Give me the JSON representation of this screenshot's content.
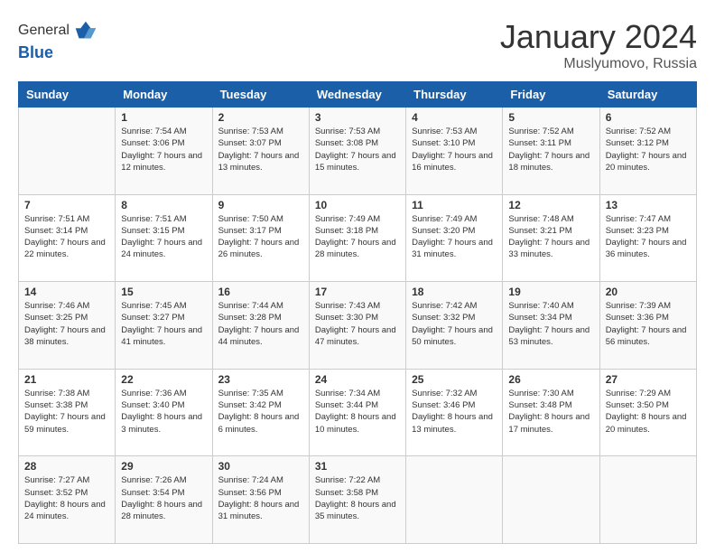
{
  "logo": {
    "line1": "General",
    "line2": "Blue"
  },
  "title": "January 2024",
  "subtitle": "Muslyumovo, Russia",
  "weekdays": [
    "Sunday",
    "Monday",
    "Tuesday",
    "Wednesday",
    "Thursday",
    "Friday",
    "Saturday"
  ],
  "weeks": [
    [
      {
        "day": "",
        "sunrise": "",
        "sunset": "",
        "daylight": ""
      },
      {
        "day": "1",
        "sunrise": "Sunrise: 7:54 AM",
        "sunset": "Sunset: 3:06 PM",
        "daylight": "Daylight: 7 hours and 12 minutes."
      },
      {
        "day": "2",
        "sunrise": "Sunrise: 7:53 AM",
        "sunset": "Sunset: 3:07 PM",
        "daylight": "Daylight: 7 hours and 13 minutes."
      },
      {
        "day": "3",
        "sunrise": "Sunrise: 7:53 AM",
        "sunset": "Sunset: 3:08 PM",
        "daylight": "Daylight: 7 hours and 15 minutes."
      },
      {
        "day": "4",
        "sunrise": "Sunrise: 7:53 AM",
        "sunset": "Sunset: 3:10 PM",
        "daylight": "Daylight: 7 hours and 16 minutes."
      },
      {
        "day": "5",
        "sunrise": "Sunrise: 7:52 AM",
        "sunset": "Sunset: 3:11 PM",
        "daylight": "Daylight: 7 hours and 18 minutes."
      },
      {
        "day": "6",
        "sunrise": "Sunrise: 7:52 AM",
        "sunset": "Sunset: 3:12 PM",
        "daylight": "Daylight: 7 hours and 20 minutes."
      }
    ],
    [
      {
        "day": "7",
        "sunrise": "Sunrise: 7:51 AM",
        "sunset": "Sunset: 3:14 PM",
        "daylight": "Daylight: 7 hours and 22 minutes."
      },
      {
        "day": "8",
        "sunrise": "Sunrise: 7:51 AM",
        "sunset": "Sunset: 3:15 PM",
        "daylight": "Daylight: 7 hours and 24 minutes."
      },
      {
        "day": "9",
        "sunrise": "Sunrise: 7:50 AM",
        "sunset": "Sunset: 3:17 PM",
        "daylight": "Daylight: 7 hours and 26 minutes."
      },
      {
        "day": "10",
        "sunrise": "Sunrise: 7:49 AM",
        "sunset": "Sunset: 3:18 PM",
        "daylight": "Daylight: 7 hours and 28 minutes."
      },
      {
        "day": "11",
        "sunrise": "Sunrise: 7:49 AM",
        "sunset": "Sunset: 3:20 PM",
        "daylight": "Daylight: 7 hours and 31 minutes."
      },
      {
        "day": "12",
        "sunrise": "Sunrise: 7:48 AM",
        "sunset": "Sunset: 3:21 PM",
        "daylight": "Daylight: 7 hours and 33 minutes."
      },
      {
        "day": "13",
        "sunrise": "Sunrise: 7:47 AM",
        "sunset": "Sunset: 3:23 PM",
        "daylight": "Daylight: 7 hours and 36 minutes."
      }
    ],
    [
      {
        "day": "14",
        "sunrise": "Sunrise: 7:46 AM",
        "sunset": "Sunset: 3:25 PM",
        "daylight": "Daylight: 7 hours and 38 minutes."
      },
      {
        "day": "15",
        "sunrise": "Sunrise: 7:45 AM",
        "sunset": "Sunset: 3:27 PM",
        "daylight": "Daylight: 7 hours and 41 minutes."
      },
      {
        "day": "16",
        "sunrise": "Sunrise: 7:44 AM",
        "sunset": "Sunset: 3:28 PM",
        "daylight": "Daylight: 7 hours and 44 minutes."
      },
      {
        "day": "17",
        "sunrise": "Sunrise: 7:43 AM",
        "sunset": "Sunset: 3:30 PM",
        "daylight": "Daylight: 7 hours and 47 minutes."
      },
      {
        "day": "18",
        "sunrise": "Sunrise: 7:42 AM",
        "sunset": "Sunset: 3:32 PM",
        "daylight": "Daylight: 7 hours and 50 minutes."
      },
      {
        "day": "19",
        "sunrise": "Sunrise: 7:40 AM",
        "sunset": "Sunset: 3:34 PM",
        "daylight": "Daylight: 7 hours and 53 minutes."
      },
      {
        "day": "20",
        "sunrise": "Sunrise: 7:39 AM",
        "sunset": "Sunset: 3:36 PM",
        "daylight": "Daylight: 7 hours and 56 minutes."
      }
    ],
    [
      {
        "day": "21",
        "sunrise": "Sunrise: 7:38 AM",
        "sunset": "Sunset: 3:38 PM",
        "daylight": "Daylight: 7 hours and 59 minutes."
      },
      {
        "day": "22",
        "sunrise": "Sunrise: 7:36 AM",
        "sunset": "Sunset: 3:40 PM",
        "daylight": "Daylight: 8 hours and 3 minutes."
      },
      {
        "day": "23",
        "sunrise": "Sunrise: 7:35 AM",
        "sunset": "Sunset: 3:42 PM",
        "daylight": "Daylight: 8 hours and 6 minutes."
      },
      {
        "day": "24",
        "sunrise": "Sunrise: 7:34 AM",
        "sunset": "Sunset: 3:44 PM",
        "daylight": "Daylight: 8 hours and 10 minutes."
      },
      {
        "day": "25",
        "sunrise": "Sunrise: 7:32 AM",
        "sunset": "Sunset: 3:46 PM",
        "daylight": "Daylight: 8 hours and 13 minutes."
      },
      {
        "day": "26",
        "sunrise": "Sunrise: 7:30 AM",
        "sunset": "Sunset: 3:48 PM",
        "daylight": "Daylight: 8 hours and 17 minutes."
      },
      {
        "day": "27",
        "sunrise": "Sunrise: 7:29 AM",
        "sunset": "Sunset: 3:50 PM",
        "daylight": "Daylight: 8 hours and 20 minutes."
      }
    ],
    [
      {
        "day": "28",
        "sunrise": "Sunrise: 7:27 AM",
        "sunset": "Sunset: 3:52 PM",
        "daylight": "Daylight: 8 hours and 24 minutes."
      },
      {
        "day": "29",
        "sunrise": "Sunrise: 7:26 AM",
        "sunset": "Sunset: 3:54 PM",
        "daylight": "Daylight: 8 hours and 28 minutes."
      },
      {
        "day": "30",
        "sunrise": "Sunrise: 7:24 AM",
        "sunset": "Sunset: 3:56 PM",
        "daylight": "Daylight: 8 hours and 31 minutes."
      },
      {
        "day": "31",
        "sunrise": "Sunrise: 7:22 AM",
        "sunset": "Sunset: 3:58 PM",
        "daylight": "Daylight: 8 hours and 35 minutes."
      },
      {
        "day": "",
        "sunrise": "",
        "sunset": "",
        "daylight": ""
      },
      {
        "day": "",
        "sunrise": "",
        "sunset": "",
        "daylight": ""
      },
      {
        "day": "",
        "sunrise": "",
        "sunset": "",
        "daylight": ""
      }
    ]
  ]
}
